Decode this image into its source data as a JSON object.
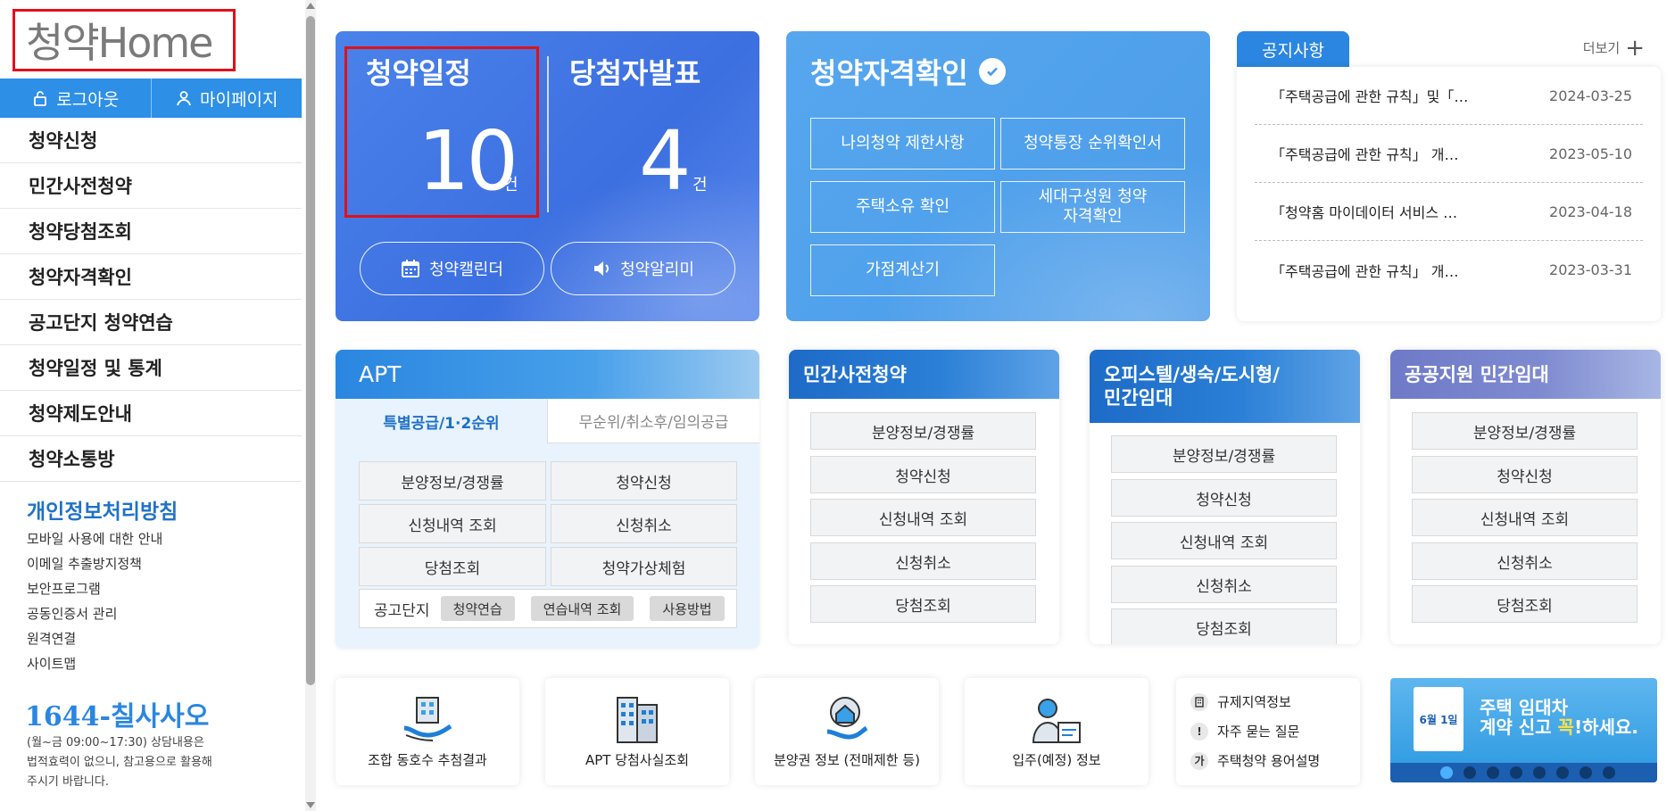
{
  "logo": {
    "text": "청약Home",
    "brand_color": "#1e7fd8"
  },
  "auth": {
    "logout": "로그아웃",
    "mypage": "마이페이지"
  },
  "nav": [
    "청약신청",
    "민간사전청약",
    "청약당첨조회",
    "청약자격확인",
    "공고단지 청약연습",
    "청약일정 및 통계",
    "청약제도안내",
    "청약소통방"
  ],
  "privacy": {
    "title": "개인정보처리방침",
    "links": [
      "모바일 사용에 대한 안내",
      "이메일 추출방지정책",
      "보안프로그램",
      "공동인증서 관리",
      "원격연결",
      "사이트맵"
    ]
  },
  "contact": {
    "phone": "1644-칠사사오",
    "note_line1": "(월~금 09:00~17:30) 상담내용은",
    "note_line2": "법적효력이 없으니, 참고용으로 활용해",
    "note_line3": "주시기 바랍니다."
  },
  "schedule": {
    "label": "청약일정",
    "count": "10",
    "unit": "건",
    "winners_label": "당첨자발표",
    "winners_count": "4",
    "winners_unit": "건",
    "calendar_btn": "청약캘린더",
    "alarm_btn": "청약알리미"
  },
  "eligibility": {
    "title": "청약자격확인",
    "buttons": [
      "나의청약 제한사항",
      "청약통장 순위확인서",
      "주택소유 확인",
      "세대구성원 청약자격확인",
      "가점계산기"
    ]
  },
  "notice": {
    "tab": "공지사항",
    "more": "더보기",
    "items": [
      {
        "text": "「주택공급에 관한 규칙」및「…",
        "date": "2024-03-25"
      },
      {
        "text": "「주택공급에 관한 규칙」 개…",
        "date": "2023-05-10"
      },
      {
        "text": "「청약홈 마이데이터 서비스 …",
        "date": "2023-04-18"
      },
      {
        "text": "「주택공급에 관한 규칙」 개…",
        "date": "2023-03-31"
      }
    ]
  },
  "apt": {
    "title": "APT",
    "tab_active": "특별공급/1·2순위",
    "tab_inactive": "무순위/취소후/임의공급",
    "buttons": [
      "분양정보/경쟁률",
      "청약신청",
      "신청내역 조회",
      "신청취소",
      "당첨조회",
      "청약가상체험"
    ],
    "practice_label": "공고단지",
    "practice_chips": [
      "청약연습",
      "연습내역 조회",
      "사용방법"
    ]
  },
  "private_presale": {
    "title": "민간사전청약",
    "buttons": [
      "분양정보/경쟁률",
      "청약신청",
      "신청내역 조회",
      "신청취소",
      "당첨조회"
    ]
  },
  "officetel": {
    "title_line1": "오피스텔/생숙/도시형/",
    "title_line2": "민간임대",
    "buttons": [
      "분양정보/경쟁률",
      "청약신청",
      "신청내역 조회",
      "신청취소",
      "당첨조회"
    ]
  },
  "public_rental": {
    "title": "공공지원 민간임대",
    "buttons": [
      "분양정보/경쟁률",
      "청약신청",
      "신청내역 조회",
      "신청취소",
      "당첨조회"
    ]
  },
  "quick_links": [
    "조합 동호수 추첨결과",
    "APT 당첨사실조회",
    "분양권 정보 (전매제한 등)",
    "입주(예정) 정보"
  ],
  "info_links": [
    {
      "icon": "building-icon",
      "label": "규제지역정보"
    },
    {
      "icon": "exclamation-icon",
      "glyph": "!",
      "label": "자주 묻는 질문"
    },
    {
      "icon": "ga-icon",
      "glyph": "가",
      "label": "주택청약 용어설명"
    }
  ],
  "banner": {
    "title_line1": "주택 임대차",
    "title_line2_a": "계약 신고 ",
    "title_line2_b": "꼭",
    "title_line2_c": "!하세요.",
    "calendar_text": "6월 1일"
  }
}
